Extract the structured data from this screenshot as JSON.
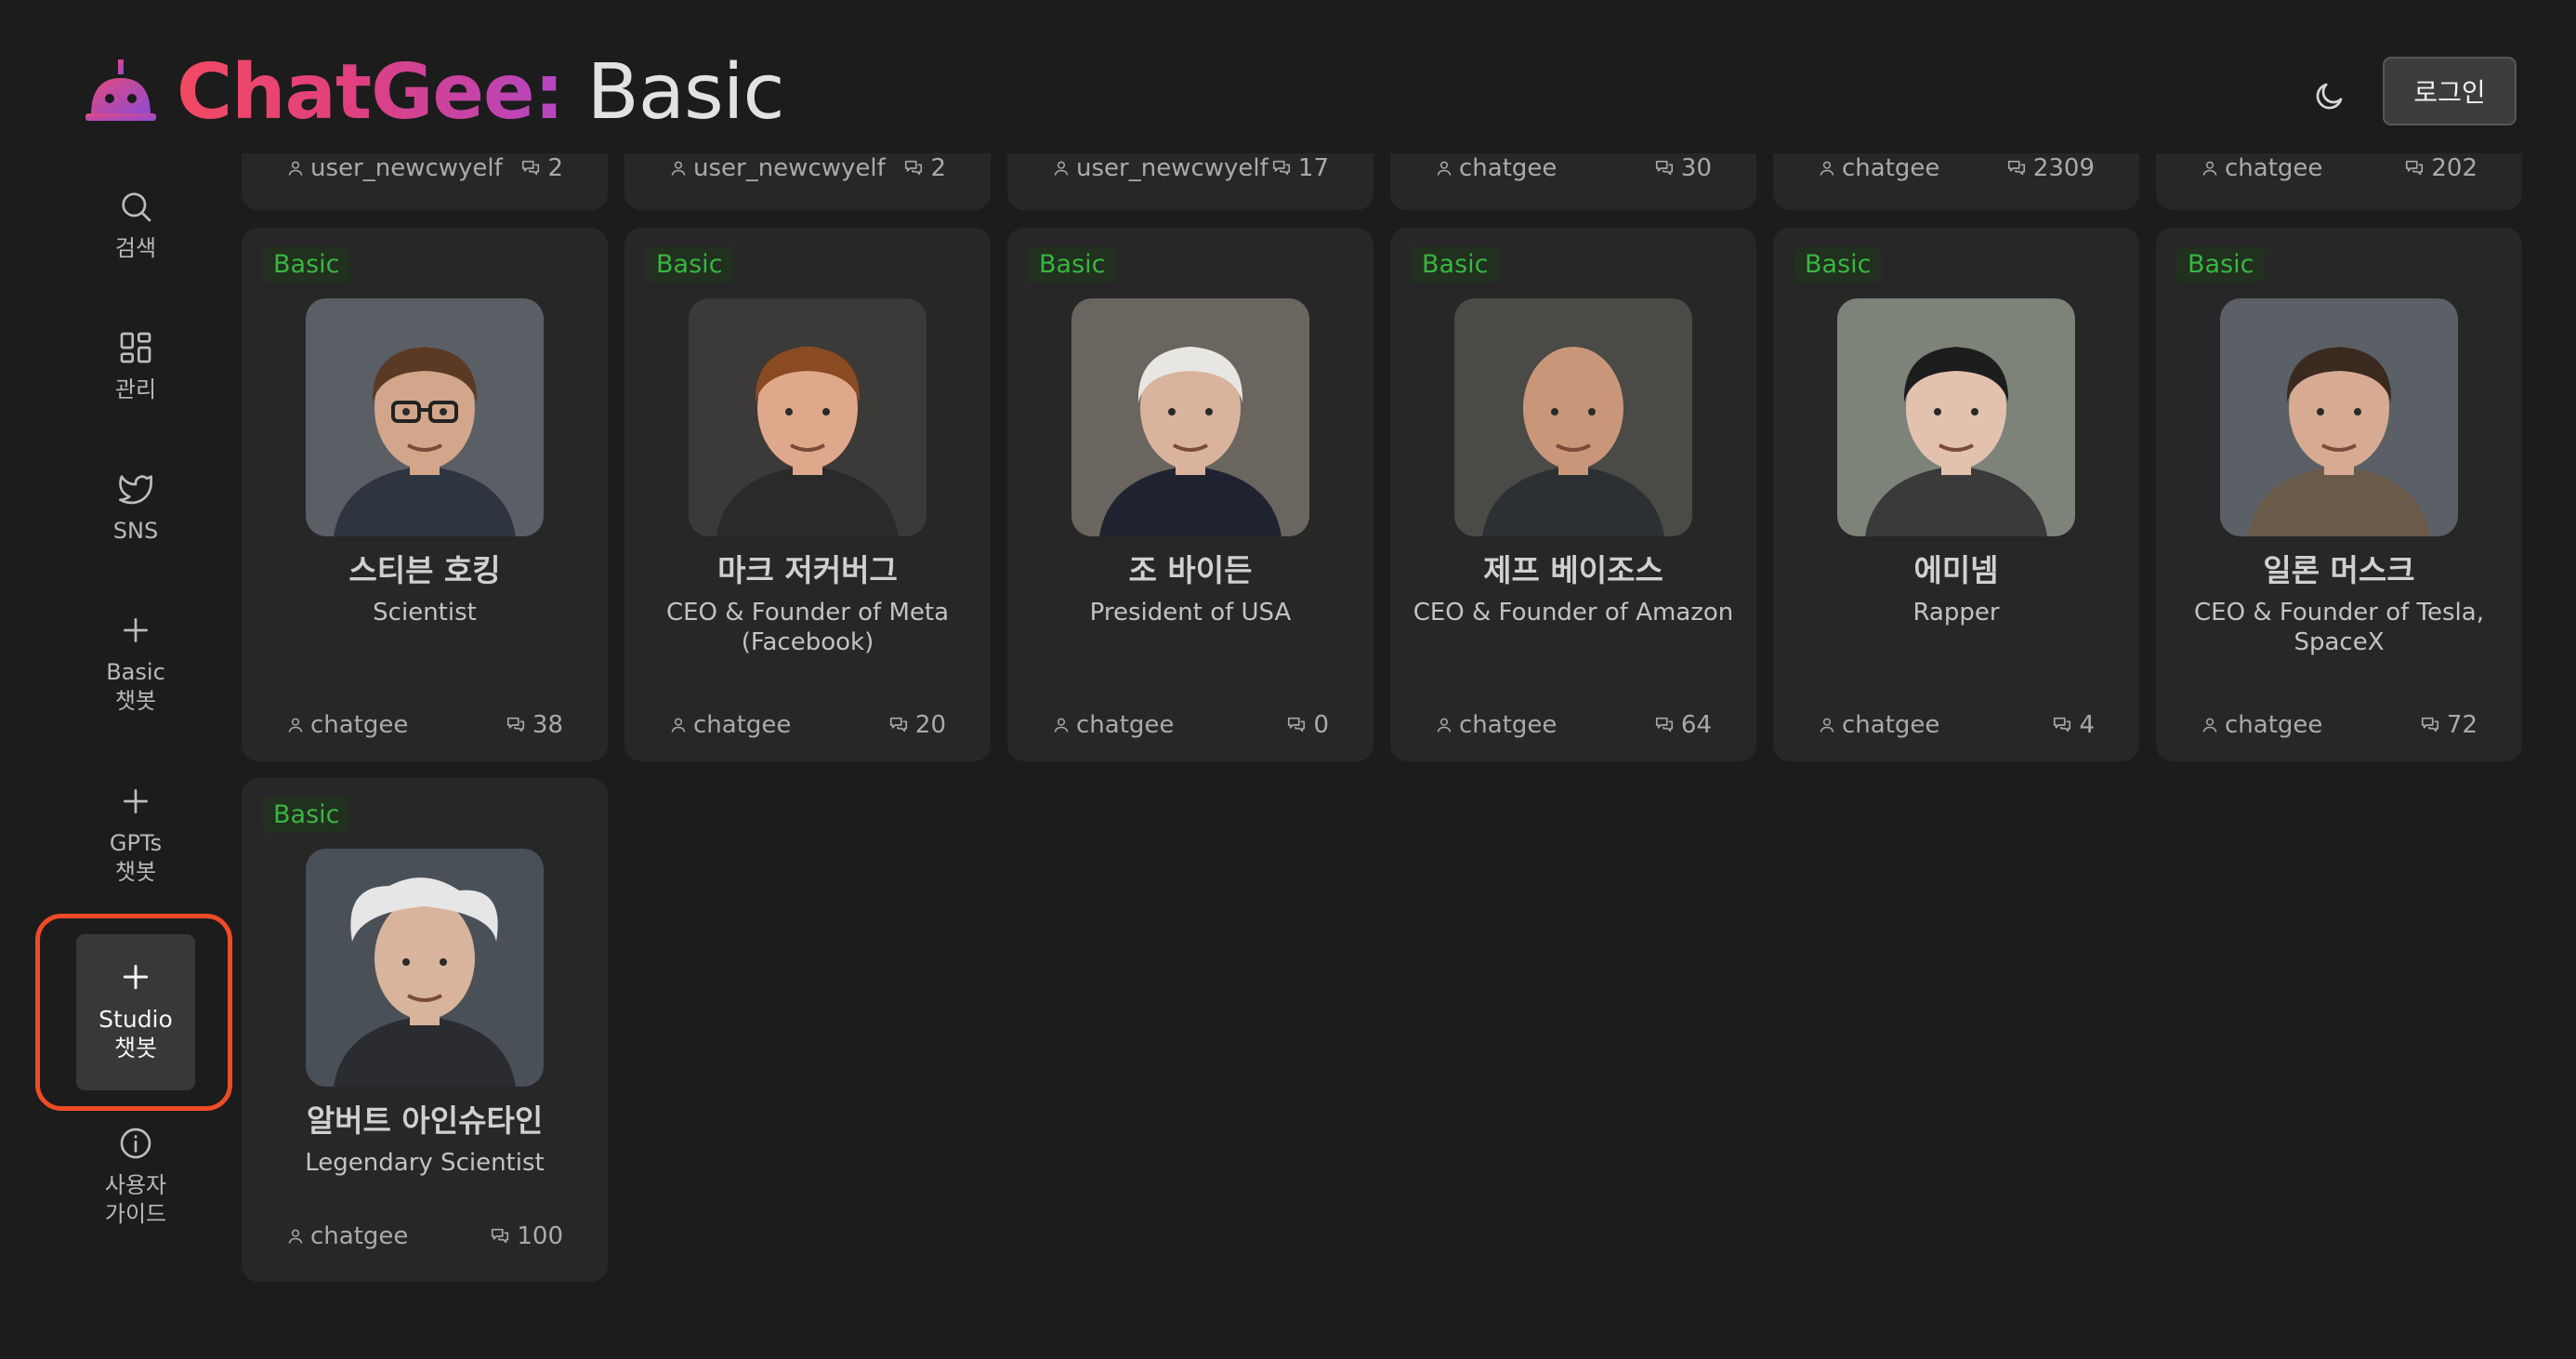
{
  "header": {
    "brand_colored": "ChatGee:",
    "brand_rest": " Basic",
    "login_label": "로그인"
  },
  "sidebar": {
    "items": [
      {
        "label": "검색",
        "icon": "search-icon"
      },
      {
        "label": "관리",
        "icon": "grid-icon"
      },
      {
        "label": "SNS",
        "icon": "twitter-icon"
      },
      {
        "label": "Basic\n챗봇",
        "icon": "plus-icon"
      },
      {
        "label": "GPTs\n챗봇",
        "icon": "plus-icon"
      },
      {
        "label": "Studio\n챗봇",
        "icon": "plus-icon",
        "active": true
      },
      {
        "label": "사용자\n가이드",
        "icon": "info-icon"
      }
    ]
  },
  "top_row": [
    {
      "creator": "user_newcwyelf",
      "count": "2"
    },
    {
      "creator": "user_newcwyelf",
      "count": "2"
    },
    {
      "creator": "user_newcwyelf",
      "count": "17"
    },
    {
      "creator": "chatgee",
      "count": "30"
    },
    {
      "creator": "chatgee",
      "count": "2309"
    },
    {
      "creator": "chatgee",
      "count": "202"
    }
  ],
  "cards": [
    {
      "badge": "Basic",
      "name": "스티븐 호킹",
      "desc": "Scientist",
      "creator": "chatgee",
      "count": "38"
    },
    {
      "badge": "Basic",
      "name": "마크 저커버그",
      "desc": "CEO & Founder of Meta (Facebook)",
      "creator": "chatgee",
      "count": "20"
    },
    {
      "badge": "Basic",
      "name": "조 바이든",
      "desc": "President of USA",
      "creator": "chatgee",
      "count": "0"
    },
    {
      "badge": "Basic",
      "name": "제프 베이조스",
      "desc": "CEO & Founder of Amazon",
      "creator": "chatgee",
      "count": "64"
    },
    {
      "badge": "Basic",
      "name": "에미넴",
      "desc": "Rapper",
      "creator": "chatgee",
      "count": "4"
    },
    {
      "badge": "Basic",
      "name": "일론 머스크",
      "desc": "CEO & Founder of Tesla, SpaceX",
      "creator": "chatgee",
      "count": "72"
    },
    {
      "badge": "Basic",
      "name": "알버트 아인슈타인",
      "desc": "Legendary Scientist",
      "creator": "chatgee",
      "count": "100"
    }
  ],
  "colors": {
    "background": "#1c1c1c",
    "card": "#272727",
    "badge_text": "#38b640",
    "highlight": "#ef4b27"
  }
}
